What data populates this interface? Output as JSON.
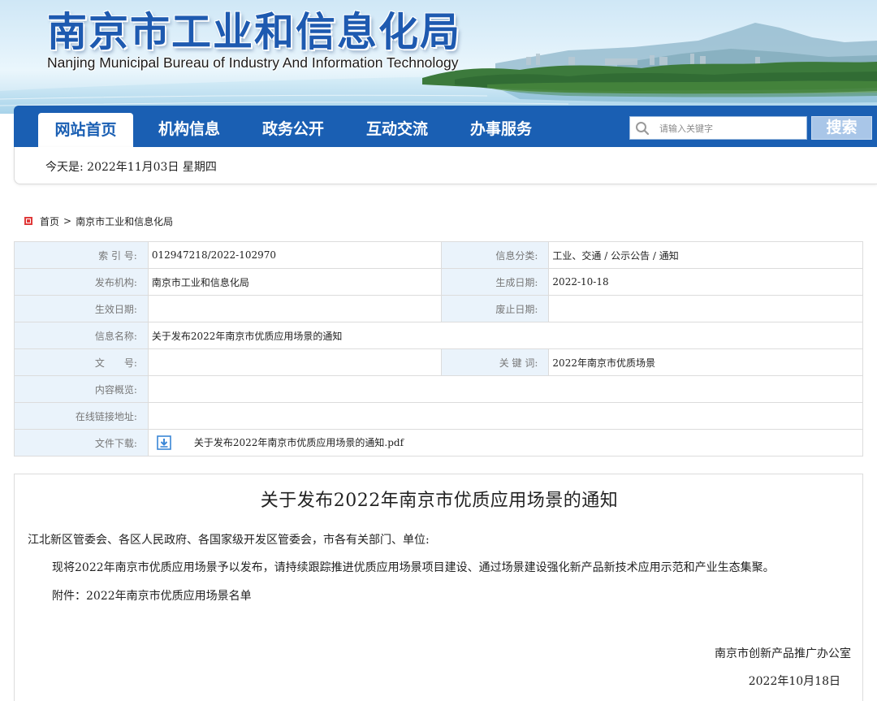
{
  "header": {
    "title_cn": "南京市工业和信息化局",
    "title_en": "Nanjing Municipal Bureau of Industry And Information Technology"
  },
  "nav": {
    "items": [
      {
        "label": "网站首页",
        "active": true
      },
      {
        "label": "机构信息",
        "active": false
      },
      {
        "label": "政务公开",
        "active": false
      },
      {
        "label": "互动交流",
        "active": false
      },
      {
        "label": "办事服务",
        "active": false
      }
    ],
    "search_placeholder": "请输入关键字",
    "search_button": "搜索"
  },
  "datebar": {
    "today": "今天是: 2022年11月03日 星期四"
  },
  "breadcrumb": {
    "home": "首页",
    "separator": ">",
    "current": "南京市工业和信息化局"
  },
  "meta": {
    "index_label": "索 引 号:",
    "index_value": "012947218/2022-102970",
    "category_label": "信息分类:",
    "category_value": "工业、交通 / 公示公告 / 通知",
    "publisher_label": "发布机构:",
    "publisher_value": "南京市工业和信息化局",
    "created_label": "生成日期:",
    "created_value": "2022-10-18",
    "effective_label": "生效日期:",
    "effective_value": "",
    "abolish_label": "废止日期:",
    "abolish_value": "",
    "name_label": "信息名称:",
    "name_value": "关于发布2022年南京市优质应用场景的通知",
    "docno_label": "文　　号:",
    "docno_value": "",
    "keywords_label": "关 键 词:",
    "keywords_value": "2022年南京市优质场景",
    "summary_label": "内容概览:",
    "summary_value": "",
    "link_label": "在线链接地址:",
    "link_value": "",
    "download_label": "文件下载:",
    "download_file": "关于发布2022年南京市优质应用场景的通知.pdf"
  },
  "article": {
    "title": "关于发布2022年南京市优质应用场景的通知",
    "salutation": "江北新区管委会、各区人民政府、各国家级开发区管委会，市各有关部门、单位:",
    "body": "现将2022年南京市优质应用场景予以发布，请持续跟踪推进优质应用场景项目建设、通过场景建设强化新产品新技术应用示范和产业生态集聚。",
    "attachment": "附件：2022年南京市优质应用场景名单",
    "signature": "南京市创新产品推广办公室",
    "date": "2022年10月18日"
  },
  "colors": {
    "primary": "#1a5fb3",
    "label_bg": "#eaf3fb",
    "border": "#dcdcdc",
    "breadcrumb_icon": "#e03a3a"
  }
}
